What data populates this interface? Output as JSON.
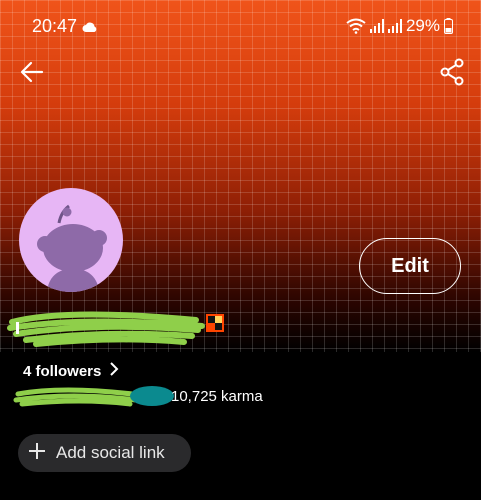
{
  "status_bar": {
    "time": "20:47",
    "battery": "29%",
    "icons": [
      "cloud-icon",
      "wifi-icon",
      "signal-icon",
      "signal-icon",
      "battery-icon"
    ]
  },
  "toolbar": {
    "back_icon": "arrow-left-icon",
    "share_icon": "share-icon"
  },
  "profile": {
    "edit_label": "Edit",
    "followers_label": "4 followers",
    "karma_label": "10,725 karma",
    "add_social_label": "Add social link"
  },
  "colors": {
    "header_accent": "#d8400f",
    "avatar_bg": "#e7b6f5",
    "avatar_figure": "#8e6aa8",
    "redaction_green": "#8fcf4a",
    "redaction_teal": "#0b8a8f",
    "chip_bg": "#2a2a2c"
  }
}
